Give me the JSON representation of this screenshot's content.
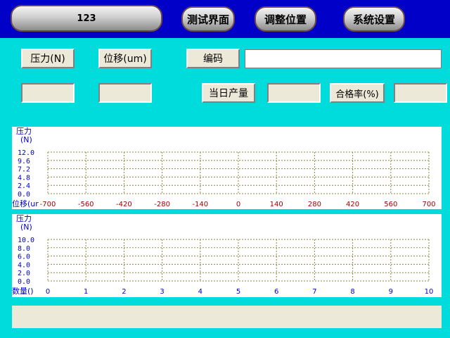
{
  "topbar": {
    "title": "123",
    "test_button": "测试界面",
    "adjust_button": "调整位置",
    "system_button": "系统设置"
  },
  "form": {
    "pressure_label": "压力(N)",
    "displacement_label": "位移(um)",
    "code_label": "编码",
    "code_value": "",
    "daily_output_label": "当日产量",
    "daily_output_value": "",
    "pass_rate_label": "合格率(%)",
    "pass_rate_value": "",
    "pressure_value": "",
    "displacement_value": ""
  },
  "chart_data": [
    {
      "type": "line",
      "ylabel_line1": "压力",
      "ylabel_line2": "(N)",
      "xlabel": "位移(ur",
      "yticks": [
        "12.0",
        "9.6",
        "7.2",
        "4.8",
        "2.4",
        "0.0"
      ],
      "xticks": [
        "-700",
        "-560",
        "-420",
        "-280",
        "-140",
        "0",
        "140",
        "280",
        "420",
        "560",
        "700"
      ],
      "ylim": [
        0,
        12
      ],
      "xlim": [
        -700,
        700
      ],
      "grid": true,
      "series": []
    },
    {
      "type": "line",
      "ylabel_line1": "压力",
      "ylabel_line2": "(N)",
      "xlabel": "数量()",
      "yticks": [
        "10.0",
        "8.0",
        "6.0",
        "4.0",
        "2.0",
        "0.0"
      ],
      "xticks": [
        "0",
        "1",
        "2",
        "3",
        "4",
        "5",
        "6",
        "7",
        "8",
        "9",
        "10"
      ],
      "ylim": [
        0,
        10
      ],
      "xlim": [
        0,
        10
      ],
      "grid": true,
      "series": []
    }
  ],
  "status": ""
}
